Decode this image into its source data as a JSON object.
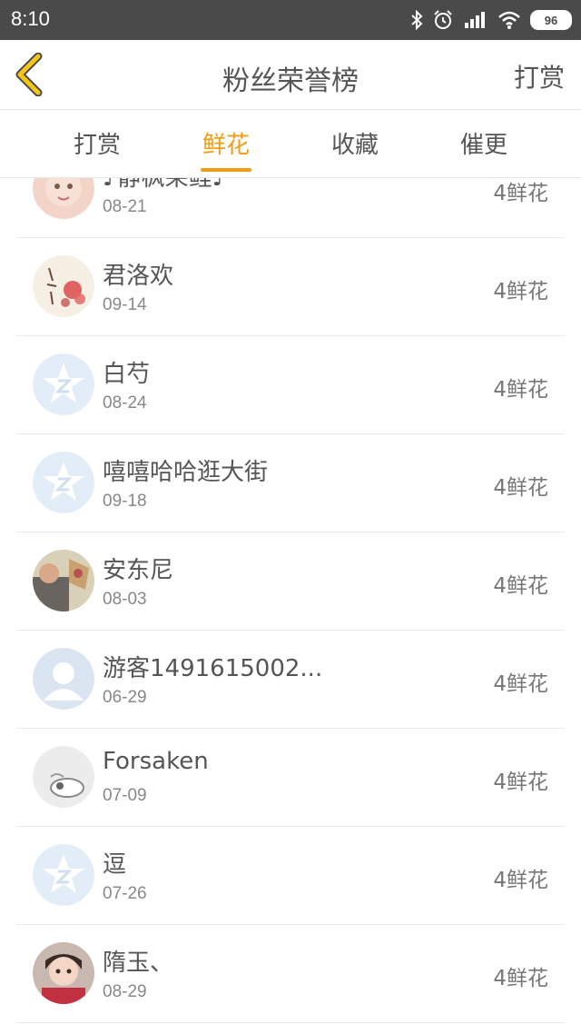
{
  "status": {
    "time": "8:10",
    "battery": "96"
  },
  "header": {
    "title": "粉丝荣誉榜",
    "action": "打赏"
  },
  "tabs": [
    {
      "label": "打赏"
    },
    {
      "label": "鲜花"
    },
    {
      "label": "收藏"
    },
    {
      "label": "催更"
    }
  ],
  "active_tab": "鲜花",
  "colors": {
    "accent": "#f39c12",
    "status_bar": "#4a4a4a",
    "back_icon": "#f5c518"
  },
  "rows": [
    {
      "name": "♪静枫呆鲤♪",
      "date": "08-21",
      "amount": "4鲜花",
      "avatar": "baby-photo"
    },
    {
      "name": "君洛欢",
      "date": "09-14",
      "amount": "4鲜花",
      "avatar": "floral-art"
    },
    {
      "name": "白芍",
      "date": "08-24",
      "amount": "4鲜花",
      "avatar": "default-star-avatar"
    },
    {
      "name": "嘻嘻哈哈逛大街",
      "date": "09-18",
      "amount": "4鲜花",
      "avatar": "default-star-avatar"
    },
    {
      "name": "安东尼",
      "date": "08-03",
      "amount": "4鲜花",
      "avatar": "photo"
    },
    {
      "name": "游客1491615002...",
      "date": "06-29",
      "amount": "4鲜花",
      "avatar": "default-person-avatar"
    },
    {
      "name": "Forsaken",
      "date": "07-09",
      "amount": "4鲜花",
      "avatar": "cartoon-avatar"
    },
    {
      "name": "逗",
      "date": "07-26",
      "amount": "4鲜花",
      "avatar": "default-star-avatar"
    },
    {
      "name": "隋玉、",
      "date": "08-29",
      "amount": "4鲜花",
      "avatar": "girl-photo"
    }
  ]
}
